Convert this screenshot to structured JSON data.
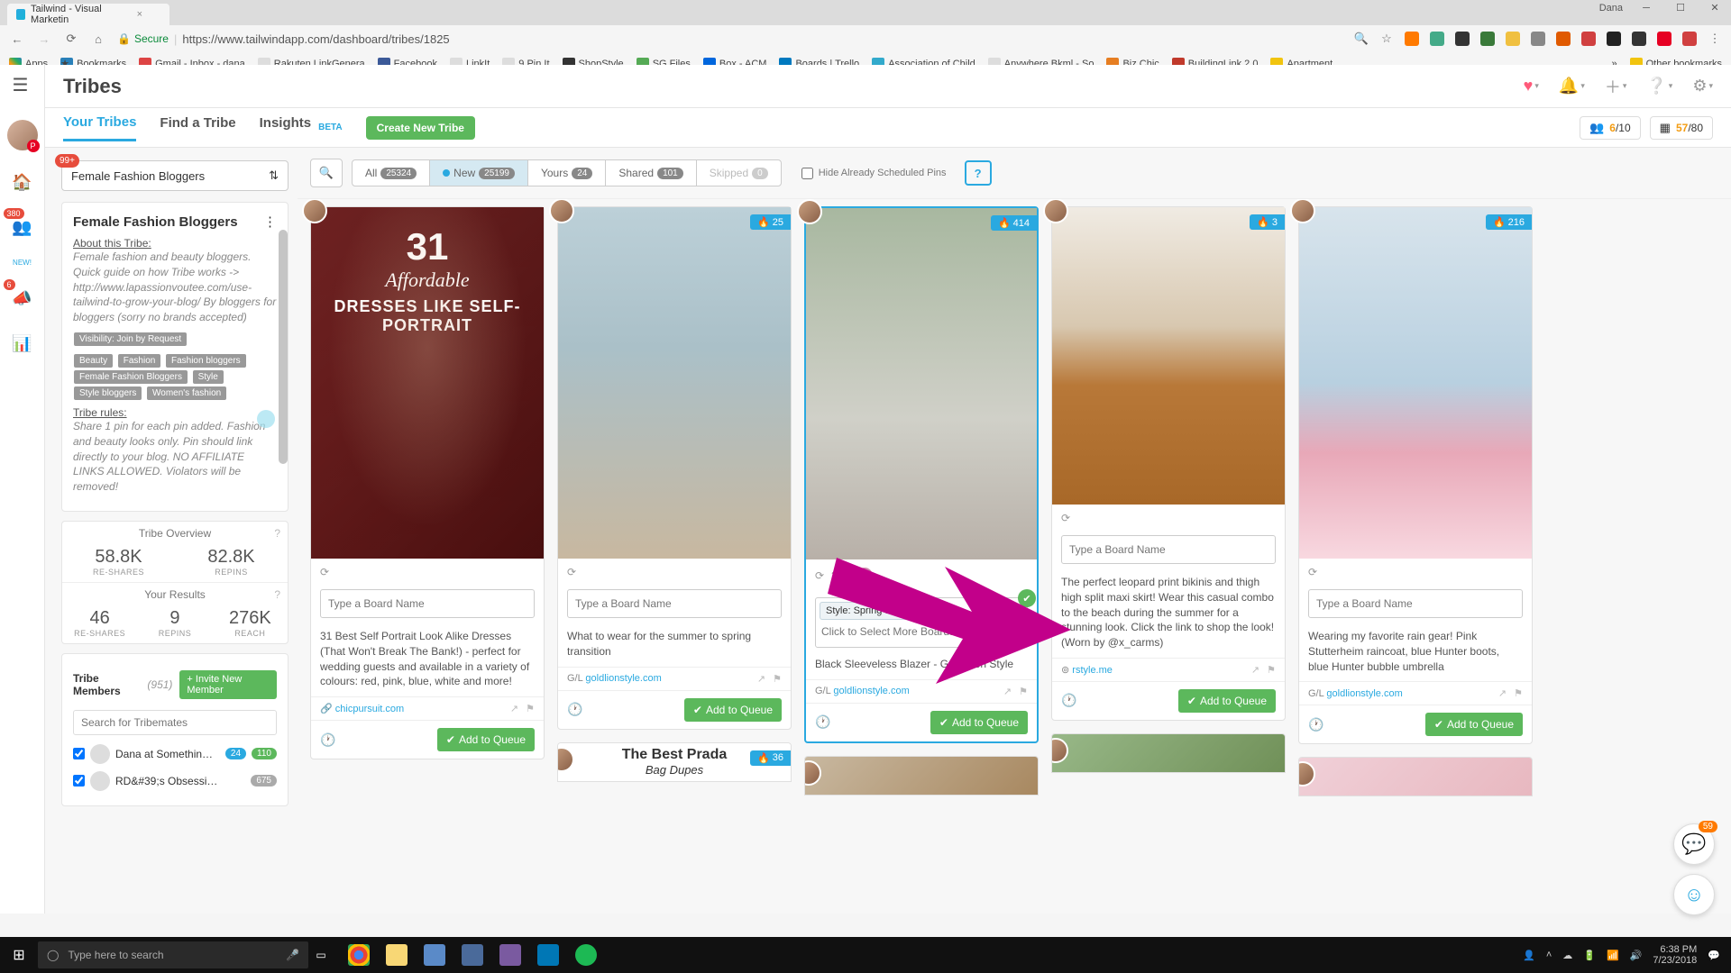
{
  "browser": {
    "tab_title": "Tailwind - Visual Marketin",
    "user": "Dana",
    "secure_label": "Secure",
    "url": "https://www.tailwindapp.com/dashboard/tribes/1825",
    "bookmarks": [
      "Apps",
      "Bookmarks",
      "Gmail - Inbox - dana",
      "Rakuten LinkGenera",
      "Facebook",
      "LinkIt",
      "9 Pin It",
      "ShopStyle",
      "SG Files",
      "Box - ACM",
      "Boards | Trello",
      "Association of Child",
      "Anywhere Bkml - So",
      "Biz Chic",
      "BuildingLink 2.0",
      "Apartment"
    ],
    "other_bookmarks": "Other bookmarks"
  },
  "app": {
    "title": "Tribes",
    "leftbar": {
      "new_label": "NEW!",
      "badge_380": "380",
      "badge_6": "6"
    },
    "subnav": {
      "your_tribes": "Your Tribes",
      "find_tribe": "Find a Tribe",
      "insights": "Insights",
      "beta": "BETA",
      "create": "Create New Tribe",
      "stat1_cur": "6",
      "stat1_max": "/10",
      "stat2_cur": "57",
      "stat2_max": "/80"
    },
    "tribe_select": {
      "name": "Female Fashion Bloggers",
      "notif": "99+"
    },
    "filters": {
      "all": "All",
      "all_n": "25324",
      "new": "New",
      "new_n": "25199",
      "yours": "Yours",
      "yours_n": "24",
      "shared": "Shared",
      "shared_n": "101",
      "skipped": "Skipped",
      "skipped_n": "0",
      "hide_label": "Hide Already Scheduled Pins"
    },
    "panel": {
      "title": "Female Fashion Bloggers",
      "about_hdr": "About this Tribe:",
      "about": "Female fashion and beauty bloggers. Quick guide on how Tribe works -> http://www.lapassionvoutee.com/use-tailwind-to-grow-your-blog/ By bloggers for bloggers (sorry no brands accepted)",
      "visibility": "Visibility: Join by Request",
      "tags": [
        "Beauty",
        "Fashion",
        "Fashion bloggers",
        "Female Fashion Bloggers",
        "Style",
        "Style bloggers",
        "Women's fashion"
      ],
      "rules_hdr": "Tribe rules:",
      "rules": "Share 1 pin for each pin added. Fashion and beauty looks only. Pin should link directly to your blog. NO AFFILIATE LINKS ALLOWED. Violators will be removed!",
      "overview_hdr": "Tribe Overview",
      "reshares_v": "58.8K",
      "reshares_l": "RE-SHARES",
      "repins_v": "82.8K",
      "repins_l": "REPINS",
      "results_hdr": "Your Results",
      "yr_reshares_v": "46",
      "yr_repins_v": "9",
      "yr_reach_v": "276K",
      "yr_reach_l": "REACH",
      "members_hdr": "Tribe Members",
      "members_count": "(951)",
      "invite": "Invite New Member",
      "search_ph": "Search for Tribemates",
      "member1": "Dana at Somethin…",
      "m1_a": "24",
      "m1_b": "110",
      "member2": "RD&#39;s Obsessi…",
      "m2_a": "675"
    },
    "cards": {
      "board_ph": "Type a Board Name",
      "queue": "Add to Queue",
      "c1": {
        "flame": "",
        "img_t1": "31",
        "img_t2": "Affordable",
        "img_t3": "DRESSES LIKE SELF-PORTRAIT",
        "desc": "31 Best Self Portrait Look Alike Dresses (That Won't Break The Bank!) - perfect for wedding guests and available in a variety of colours: red, pink, blue, white and more!",
        "src": "chicpursuit.com"
      },
      "c2": {
        "flame": "25",
        "desc": "What to wear for the summer to spring transition",
        "src": "goldlionstyle.com"
      },
      "c3": {
        "flame": "414",
        "repin_count": "2",
        "chip": "Style: Spring & Summer",
        "more_ph": "Click to Select More Boards",
        "desc": "Black Sleeveless Blazer - Gold Lion Style",
        "src": "goldlionstyle.com"
      },
      "c4": {
        "flame": "3",
        "desc": "The perfect leopard print bikinis and thigh high split maxi skirt! Wear this casual combo to the beach during the summer for a stunning look. Click the link to shop the look! (Worn by @x_carms)",
        "src": "rstyle.me"
      },
      "c5": {
        "flame": "216",
        "desc": "Wearing my favorite rain gear! Pink Stutterheim raincoat, blue Hunter boots, blue Hunter bubble umbrella",
        "src": "goldlionstyle.com"
      },
      "peek": {
        "flame": "36",
        "title1": "The Best Prada",
        "title2": "Bag Dupes"
      }
    }
  },
  "taskbar": {
    "search_ph": "Type here to search",
    "time": "6:38 PM",
    "date": "7/23/2018"
  },
  "chat_badge": "59"
}
